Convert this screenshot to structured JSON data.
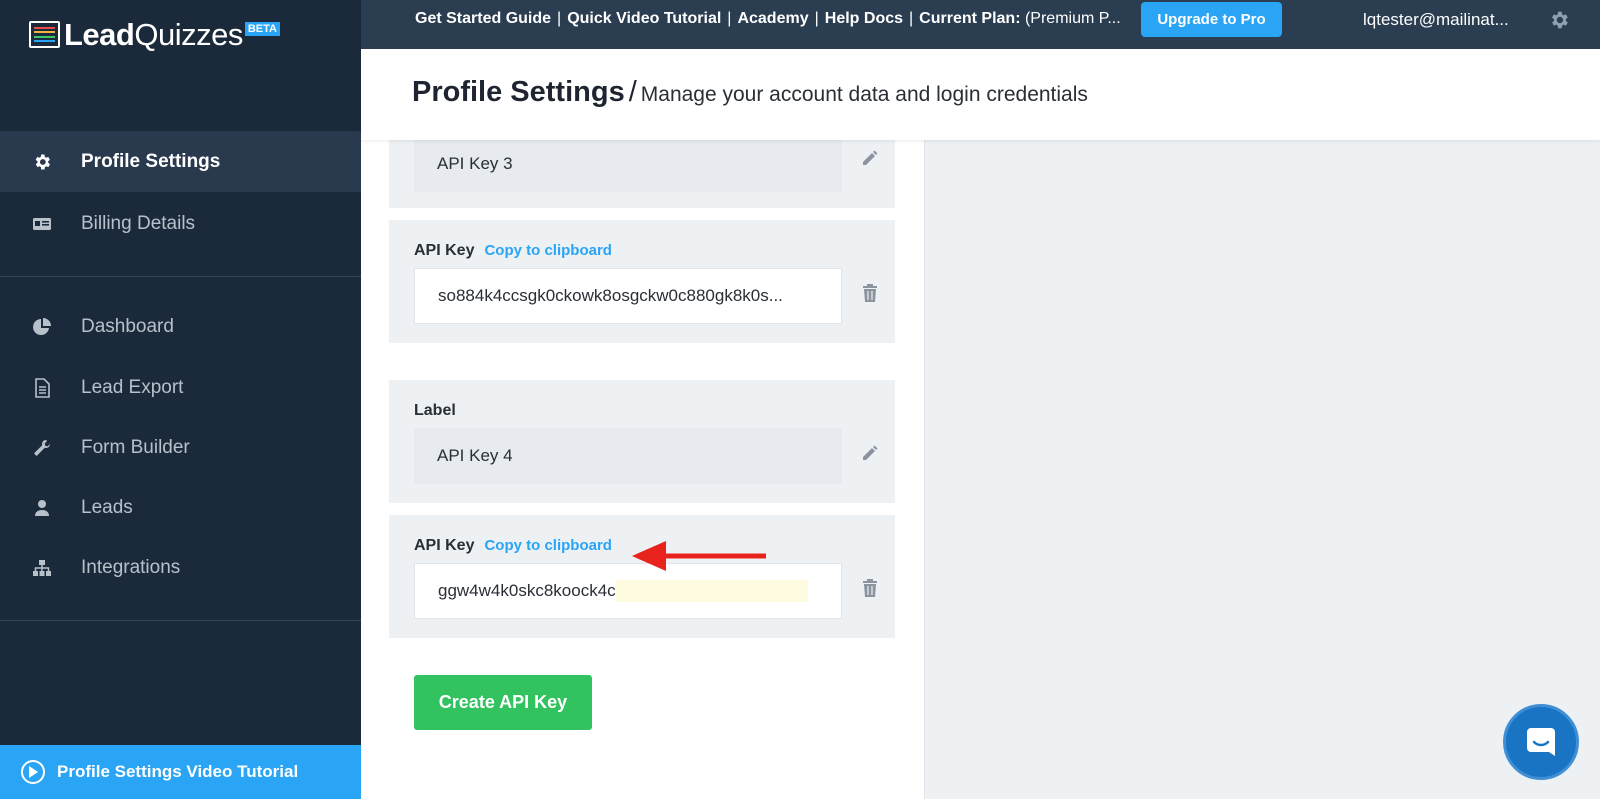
{
  "logo": {
    "text_a": "Lead",
    "text_b": "Quizzes",
    "badge": "BETA",
    "stripe_colors": [
      "#e84c4c",
      "#f5b13d",
      "#3cc36b",
      "#2aa4f4"
    ]
  },
  "topbar": {
    "links": [
      "Get Started Guide",
      "Quick Video Tutorial",
      "Academy",
      "Help Docs"
    ],
    "plan_label": "Current Plan:",
    "plan_value": "(Premium P...",
    "upgrade_label": "Upgrade to Pro",
    "user_email": "lqtester@mailinat...",
    "gear_icon": "gear-icon"
  },
  "sidebar": {
    "items": [
      {
        "label": "Profile Settings",
        "icon": "gear-icon",
        "active": true
      },
      {
        "label": "Billing Details",
        "icon": "id-card-icon",
        "active": false
      },
      {
        "label": "Dashboard",
        "icon": "pie-chart-icon",
        "active": false
      },
      {
        "label": "Lead Export",
        "icon": "document-icon",
        "active": false
      },
      {
        "label": "Form Builder",
        "icon": "wrench-icon",
        "active": false
      },
      {
        "label": "Leads",
        "icon": "user-icon",
        "active": false
      },
      {
        "label": "Integrations",
        "icon": "sitemap-icon",
        "active": false
      }
    ],
    "video_tutorial": "Profile Settings Video Tutorial"
  },
  "header": {
    "title": "Profile Settings",
    "separator": "/",
    "subtitle": "Manage your account data and login credentials"
  },
  "api_keys": [
    {
      "label_value": "API Key 3",
      "key_label": "API Key",
      "copy_label": "Copy to clipboard",
      "key_value": "so884k4ccsgk0ckowk8osgckw0c880gk8k0s..."
    },
    {
      "field_label": "Label",
      "label_value": "API Key 4",
      "key_label": "API Key",
      "copy_label": "Copy to clipboard",
      "key_value": "ggw4w4k0skc8koock4c"
    }
  ],
  "create_button": "Create API Key",
  "colors": {
    "sidebar_bg": "#1b2a3a",
    "topbar_bg": "#2b3d51",
    "accent_blue": "#2aa4f4",
    "green": "#33c260",
    "arrow_red": "#e8221c"
  }
}
